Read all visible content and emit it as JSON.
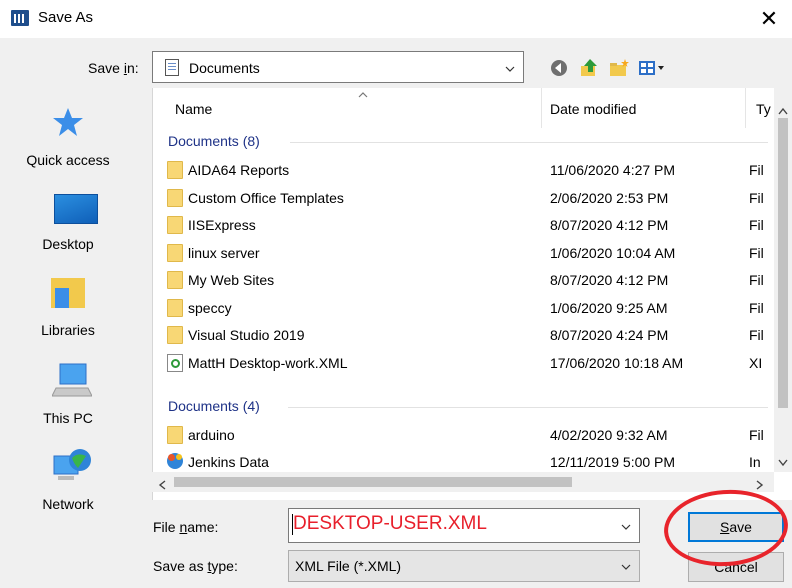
{
  "window": {
    "title": "Save As",
    "close_glyph": "✕"
  },
  "save_in": {
    "label_prefix": "Save ",
    "label_accel": "i",
    "label_suffix": "n:",
    "value": "Documents"
  },
  "toolbar": {
    "icons": [
      "back-icon",
      "up-folder-icon",
      "new-folder-icon",
      "view-menu-icon"
    ]
  },
  "places": [
    {
      "label": "Quick access",
      "icon": "star-icon"
    },
    {
      "label": "Desktop",
      "icon": "desktop-icon"
    },
    {
      "label": "Libraries",
      "icon": "libraries-icon"
    },
    {
      "label": "This PC",
      "icon": "computer-icon"
    },
    {
      "label": "Network",
      "icon": "network-icon"
    }
  ],
  "columns": {
    "name": "Name",
    "date": "Date modified",
    "type": "Ty"
  },
  "groups": [
    {
      "header": "Documents (8)",
      "items": [
        {
          "name": "AIDA64 Reports",
          "date": "11/06/2020 4:27 PM",
          "type": "Fil",
          "icon": "folder-icon"
        },
        {
          "name": "Custom Office Templates",
          "date": "2/06/2020 2:53 PM",
          "type": "Fil",
          "icon": "folder-icon"
        },
        {
          "name": "IISExpress",
          "date": "8/07/2020 4:12 PM",
          "type": "Fil",
          "icon": "folder-icon"
        },
        {
          "name": "linux server",
          "date": "1/06/2020 10:04 AM",
          "type": "Fil",
          "icon": "folder-icon"
        },
        {
          "name": "My Web Sites",
          "date": "8/07/2020 4:12 PM",
          "type": "Fil",
          "icon": "folder-icon"
        },
        {
          "name": "speccy",
          "date": "1/06/2020 9:25 AM",
          "type": "Fil",
          "icon": "folder-icon"
        },
        {
          "name": "Visual Studio 2019",
          "date": "8/07/2020 4:24 PM",
          "type": "Fil",
          "icon": "folder-icon"
        },
        {
          "name": "MattH Desktop-work.XML",
          "date": "17/06/2020 10:18 AM",
          "type": "XI",
          "icon": "xml-file-icon"
        }
      ]
    },
    {
      "header": "Documents (4)",
      "items": [
        {
          "name": "arduino",
          "date": "4/02/2020 9:32 AM",
          "type": "Fil",
          "icon": "folder-icon"
        },
        {
          "name": "Jenkins Data",
          "date": "12/11/2019 5:00 PM",
          "type": "In",
          "icon": "shortcut-icon"
        }
      ]
    }
  ],
  "file_name": {
    "label_prefix": "File ",
    "label_accel": "n",
    "label_suffix": "ame:",
    "value": "DESKTOP-USER.XML"
  },
  "file_type": {
    "label_prefix": "Save as ",
    "label_accel": "t",
    "label_suffix": "ype:",
    "value": "XML File (*.XML)"
  },
  "buttons": {
    "save_accel": "S",
    "save_rest": "ave",
    "cancel": "Cancel"
  },
  "colors": {
    "annotation": "#e8242b",
    "group_header": "#1e3287",
    "focus": "#0078d7"
  }
}
